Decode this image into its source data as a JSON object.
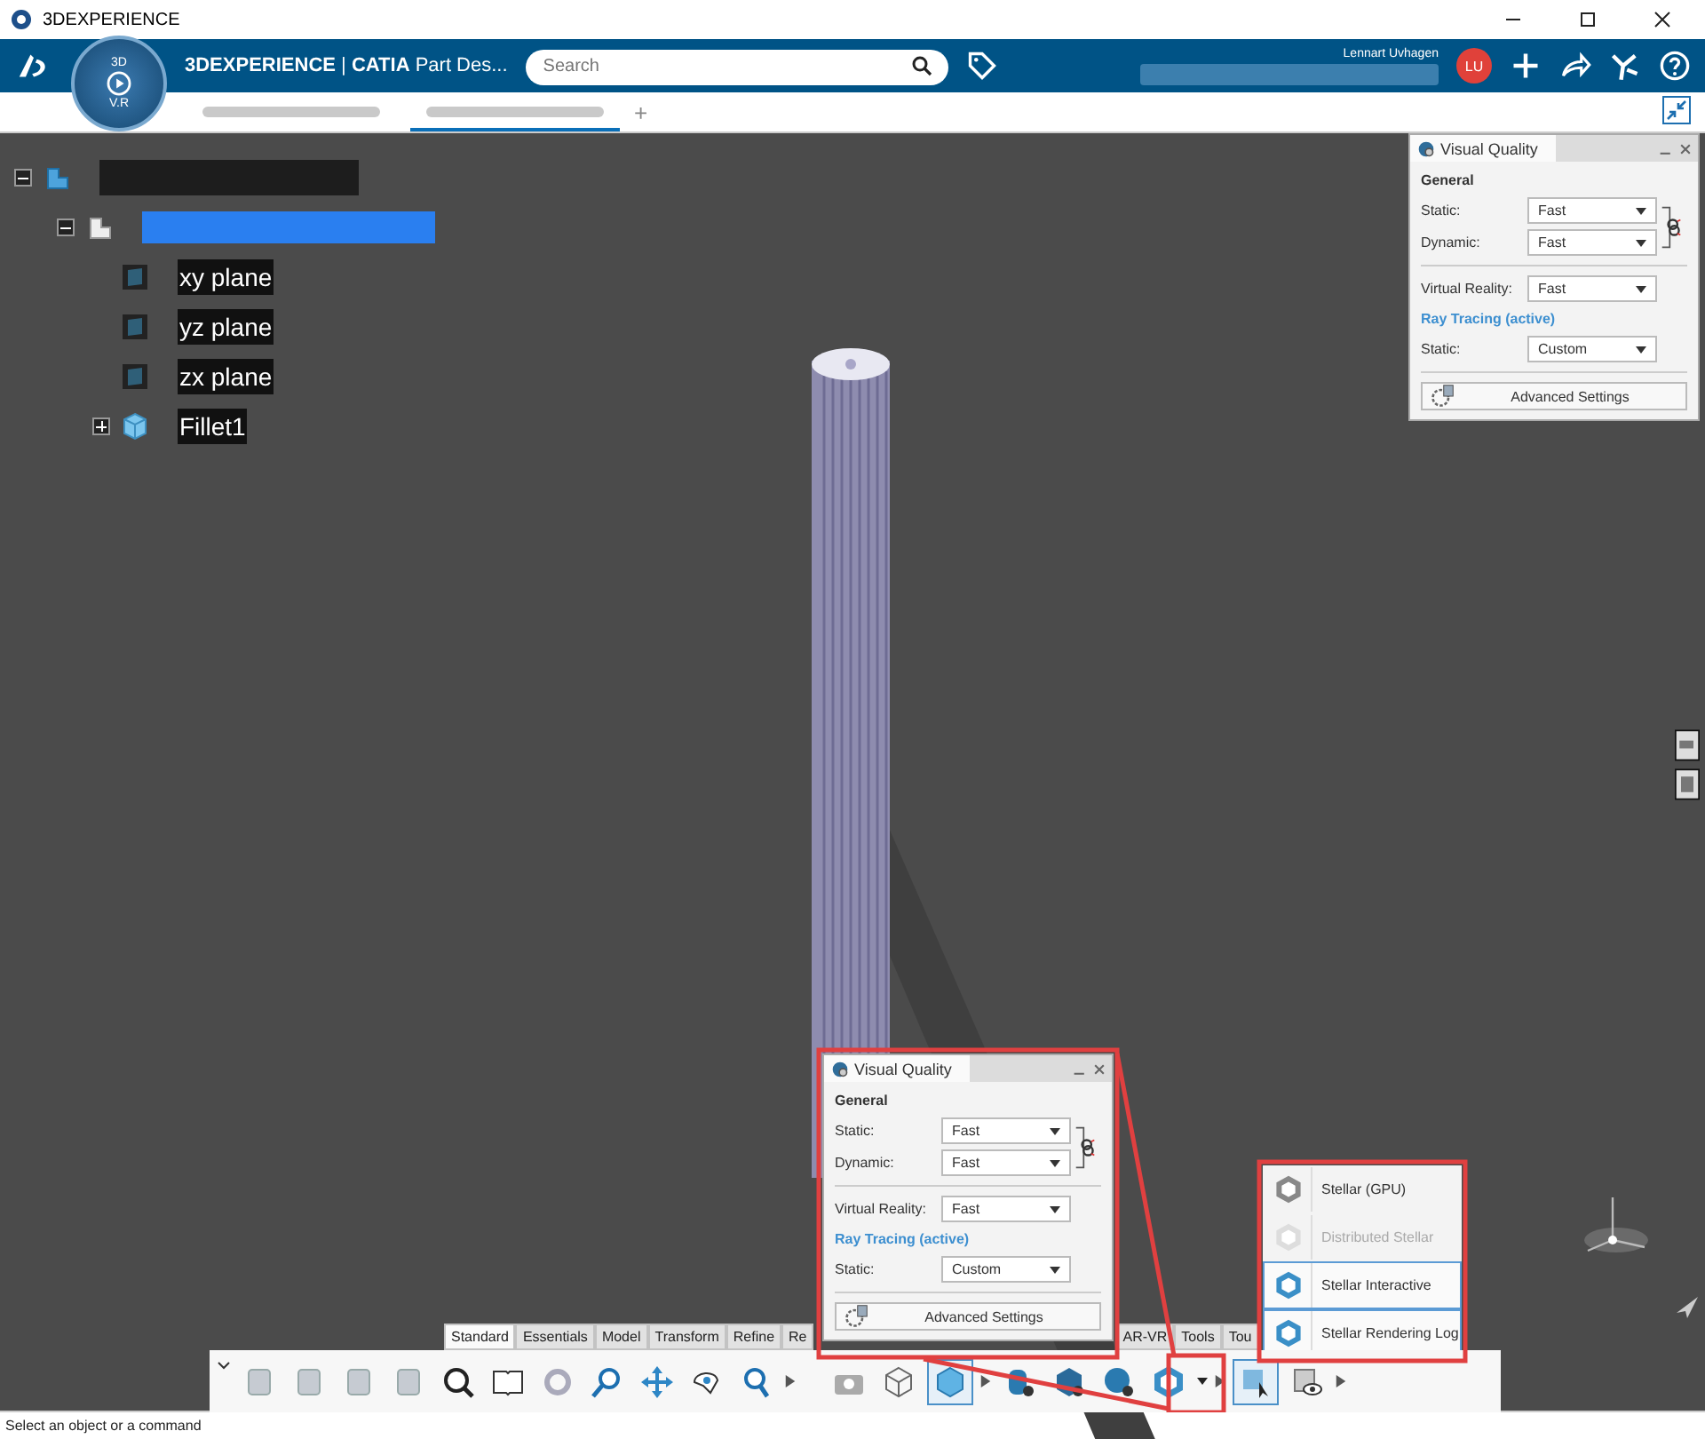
{
  "window": {
    "title": "3DEXPERIENCE"
  },
  "header": {
    "brand": "3DEXPERIENCE",
    "separator": "|",
    "app": "CATIA",
    "app_suffix": "Part Des...",
    "compass_top": "3D",
    "compass_bottom": "V.R",
    "search": {
      "placeholder": "Search"
    },
    "user": "Lennart Uvhagen",
    "avatar": "LU"
  },
  "tabs": [
    {
      "selected": false
    },
    {
      "selected": true
    }
  ],
  "tab_add": "+",
  "tree": {
    "kind": "product",
    "expanded": true,
    "children": [
      {
        "kind": "part",
        "selected": true,
        "expanded": true,
        "children": [
          {
            "kind": "plane",
            "label": "xy plane"
          },
          {
            "kind": "plane",
            "label": "yz plane"
          },
          {
            "kind": "plane",
            "label": "zx plane"
          },
          {
            "kind": "body",
            "label": "Fillet1",
            "expanded": false
          }
        ]
      }
    ]
  },
  "visual_quality_panels": [
    {
      "title": "Visual Quality",
      "section": "General",
      "fields": [
        {
          "label": "Static:",
          "value": "Fast"
        },
        {
          "label": "Dynamic:",
          "value": "Fast"
        },
        {
          "label": "Virtual Reality:",
          "value": "Fast"
        }
      ],
      "ray_tracing": "Ray Tracing (active)",
      "ray_fields": [
        {
          "label": "Static:",
          "value": "Custom"
        }
      ],
      "button": "Advanced Settings"
    },
    {
      "title": "Visual Quality",
      "section": "General",
      "fields": [
        {
          "label": "Static:",
          "value": "Fast"
        },
        {
          "label": "Dynamic:",
          "value": "Fast"
        },
        {
          "label": "Virtual Reality:",
          "value": "Fast"
        }
      ],
      "ray_tracing": "Ray Tracing (active)",
      "ray_fields": [
        {
          "label": "Static:",
          "value": "Custom"
        }
      ],
      "button": "Advanced Settings"
    }
  ],
  "stellar_menu": [
    {
      "label": "Stellar (GPU)",
      "disabled": false,
      "selected": false
    },
    {
      "label": "Distributed Stellar",
      "disabled": true,
      "selected": false
    },
    {
      "label": "Stellar Interactive",
      "disabled": false,
      "selected": true
    },
    {
      "label": "Stellar Rendering Log",
      "disabled": false,
      "selected": true
    }
  ],
  "ribbon_tabs": {
    "left": [
      {
        "label": "Standard",
        "selected": true
      },
      {
        "label": "Essentials",
        "selected": false
      },
      {
        "label": "Model",
        "selected": false
      },
      {
        "label": "Transform",
        "selected": false
      },
      {
        "label": "Refine",
        "selected": false
      },
      {
        "label": "Re",
        "selected": false
      }
    ],
    "right": [
      {
        "label": "AR-VR",
        "selected": false
      },
      {
        "label": "Tools",
        "selected": false
      },
      {
        "label": "Tou",
        "selected": false
      }
    ]
  },
  "status_bar": "Select an object or a command"
}
